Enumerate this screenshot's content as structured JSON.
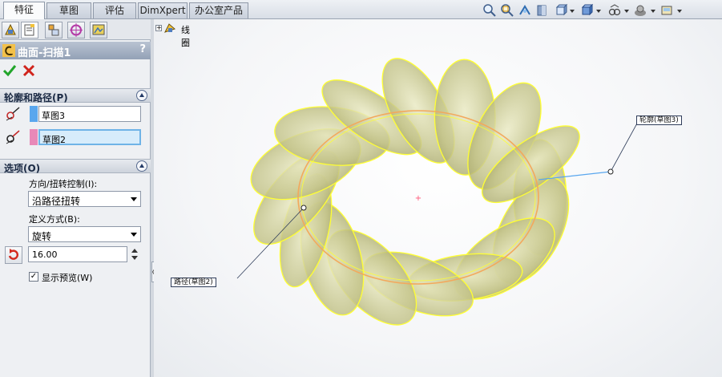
{
  "tabs": [
    {
      "label": "特征",
      "active": true
    },
    {
      "label": "草图",
      "active": false
    },
    {
      "label": "评估",
      "active": false
    },
    {
      "label": "DimXpert",
      "active": false
    },
    {
      "label": "办公室产品",
      "active": false
    }
  ],
  "view_toolbar": {
    "icons": [
      "zoom-to-fit-icon",
      "zoom-area-icon",
      "previous-view-icon",
      "section-view-icon",
      "view-orientation-icon",
      "display-style-icon",
      "hide-show-items-icon",
      "appearance-icon",
      "scene-icon"
    ]
  },
  "property_manager": {
    "tab_icons": [
      "feature-manager-icon",
      "property-manager-icon",
      "configuration-manager-icon",
      "dimxpert-manager-icon",
      "display-manager-icon"
    ],
    "title": "曲面-扫描1",
    "help": "?",
    "profile_path_group": {
      "title": "轮廓和路径(P)",
      "profile_value": "草图3",
      "path_value": "草图2",
      "profile_color": "#5aa7ee",
      "path_color": "#e889b8"
    },
    "options_group": {
      "title": "选项(O)",
      "orientation_label": "方向/扭转控制(I):",
      "orientation_value": "沿路径扭转",
      "define_by_label": "定义方式(B):",
      "define_by_value": "旋转",
      "twist_value": "16.00",
      "show_preview_label": "显示预览(W)",
      "show_preview_checked": true
    }
  },
  "viewport": {
    "tree_label": "线圈",
    "callout_profile": "轮廓(草图3)",
    "callout_path": "路径(草图2)"
  },
  "colors": {
    "surface_fill": "#c9c98a",
    "surface_edge": "#ffff33",
    "path_line": "#f3a85d",
    "accent_blue": "#5aa7ee"
  }
}
